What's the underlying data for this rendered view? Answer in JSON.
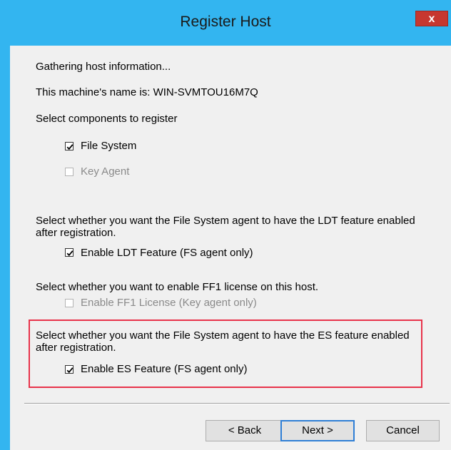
{
  "window": {
    "title": "Register Host",
    "close_label": "x"
  },
  "content": {
    "gathering_text": "Gathering host information...",
    "machine_name_text": "This machine's name is: WIN-SVMTOU16M7Q",
    "select_components_text": "Select components to register",
    "components": [
      {
        "label": "File System",
        "checked": true,
        "enabled": true
      },
      {
        "label": "Key Agent",
        "checked": false,
        "enabled": false
      }
    ],
    "ldt_prompt": "Select whether you want the File System agent to have the LDT feature enabled after registration.",
    "ldt_checkbox": {
      "label": "Enable LDT Feature (FS agent only)",
      "checked": true,
      "enabled": true
    },
    "ff1_prompt": "Select whether you want to enable FF1 license on this host.",
    "ff1_checkbox": {
      "label": "Enable FF1 License (Key agent only)",
      "checked": false,
      "enabled": false
    },
    "es_prompt": "Select whether you want the File System agent to have the ES feature enabled after registration.",
    "es_checkbox": {
      "label": "Enable ES Feature (FS agent only)",
      "checked": true,
      "enabled": true
    }
  },
  "buttons": {
    "back": "< Back",
    "next": "Next >",
    "cancel": "Cancel"
  },
  "colors": {
    "titlebar": "#33b5f0",
    "highlight_border": "#e8334a",
    "close_button": "#c7372f"
  }
}
